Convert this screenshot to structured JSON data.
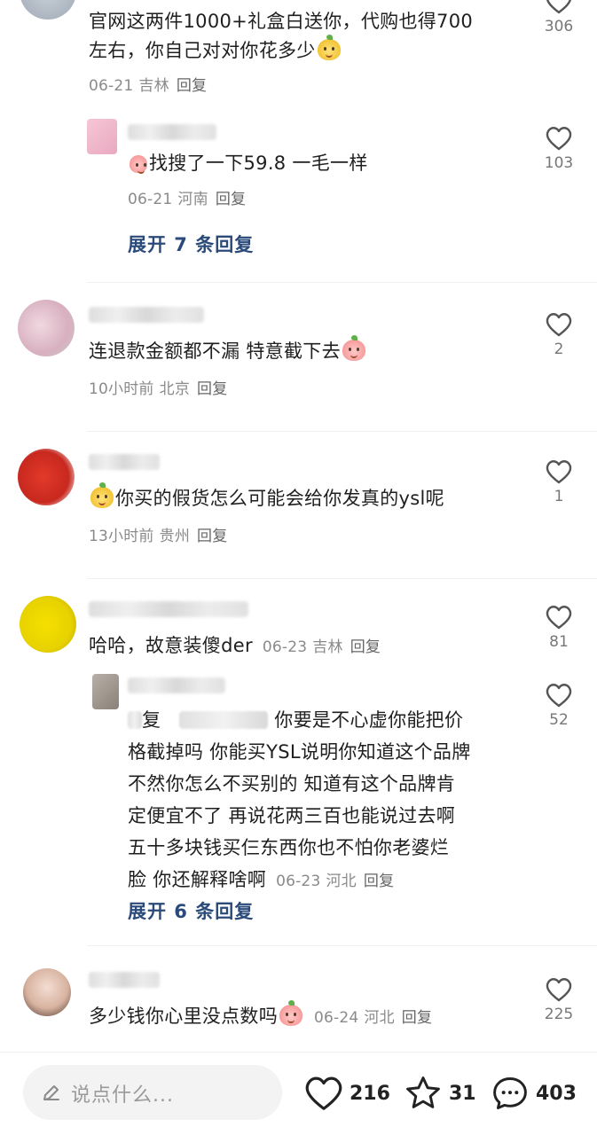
{
  "comments": [
    {
      "text": "官网这两件1000+礼盒白送你，代购也得700左右，你自己对对你花多少",
      "text_line1": "官网这两件1000+礼盒白送你，代购也得700",
      "text_line2": "左右，你自己对对你花多少",
      "time": "06-21",
      "location": "吉林",
      "reply": "回复",
      "likes": "306"
    },
    {
      "text": "找搜了一下59.8 一毛一样",
      "time": "06-21",
      "location": "河南",
      "reply": "回复",
      "likes": "103",
      "expand": "展开 7 条回复"
    },
    {
      "text": "连退款金额都不漏  特意截下去",
      "time": "10小时前",
      "location": "北京",
      "reply": "回复",
      "likes": "2"
    },
    {
      "text": "你买的假货怎么可能会给你发真的ysl呢",
      "time": "13小时前",
      "location": "贵州",
      "reply": "回复",
      "likes": "1"
    },
    {
      "text": "哈哈，故意装傻der",
      "time": "06-23",
      "location": "吉林",
      "reply": "回复",
      "likes": "81"
    },
    {
      "reply_prefix": "复",
      "text_lines": [
        "你要是不心虚你能把价",
        "格截掉吗 你能买YSL说明你知道这个品牌",
        "不然你怎么不买别的 知道有这个品牌肯",
        "定便宜不了 再说花两三百也能说过去啊",
        "五十多块钱买仨东西你也不怕你老婆烂",
        "脸 你还解释啥啊"
      ],
      "time": "06-23",
      "location": "河北",
      "reply": "回复",
      "likes": "52",
      "expand": "展开 6 条回复"
    },
    {
      "text": "多少钱你心里没点数吗",
      "time": "06-24",
      "location": "河北",
      "reply": "回复",
      "likes": "225"
    }
  ],
  "bottom_bar": {
    "placeholder": "说点什么...",
    "likes": "216",
    "favorites": "31",
    "comments": "403"
  },
  "colors": {
    "expand_link": "#2a4a7a",
    "meta_text": "#8a8a8a",
    "input_bg": "#f3f3f3"
  },
  "icons": [
    "heart-icon",
    "star-icon",
    "comment-bubble-icon",
    "pencil-icon"
  ]
}
